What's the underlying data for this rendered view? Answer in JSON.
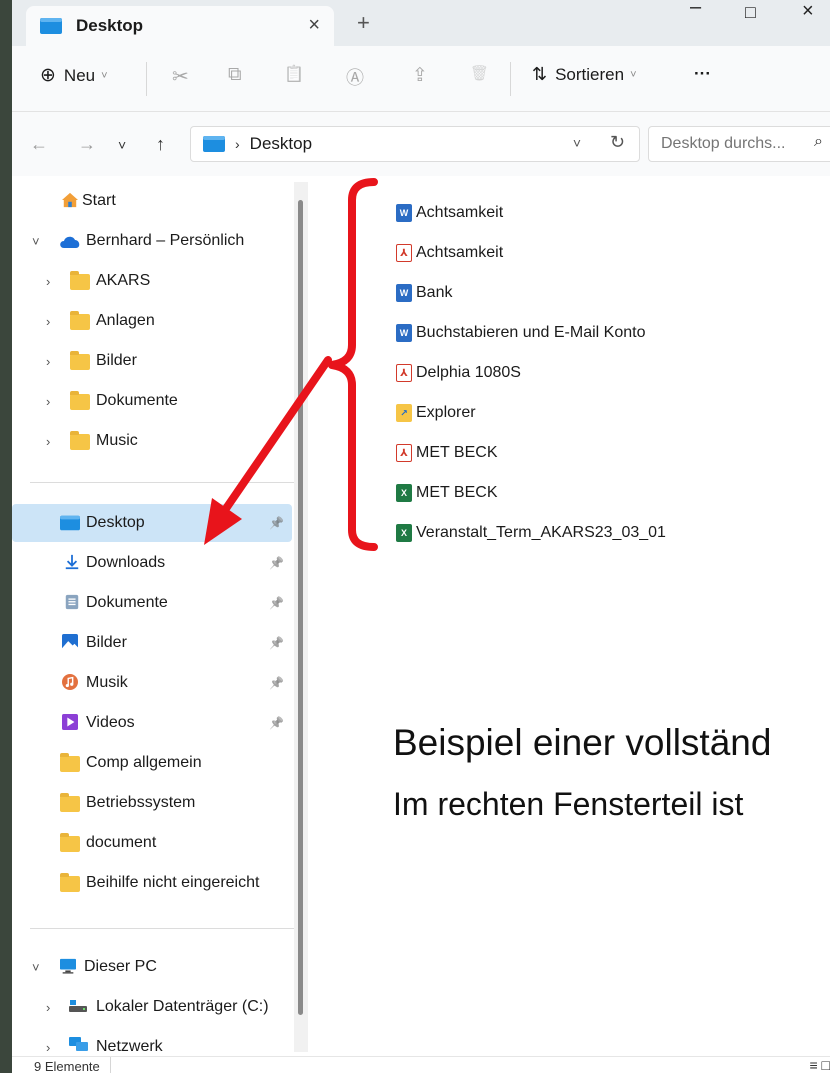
{
  "window": {
    "tab_title": "Desktop",
    "tab_close": "×",
    "new_tab": "+",
    "minimize": "–",
    "maximize": "□",
    "close": "×"
  },
  "toolbar": {
    "new_icon": "⊕",
    "new_label": "Neu",
    "new_chevron": "˅",
    "cut_icon": "✂",
    "copy_icon": "⧉",
    "paste_icon": "📋",
    "rename_icon": "Ⓐ",
    "share_icon": "⇪",
    "delete_icon": "🗑",
    "sort_icon": "⇅",
    "sort_label": "Sortieren",
    "sort_chevron": "˅",
    "more_label": "···"
  },
  "navigation": {
    "back": "←",
    "forward": "→",
    "recent": "˅",
    "up": "↑"
  },
  "address": {
    "separator": "›",
    "crumb": "Desktop",
    "dropdown": "˅",
    "refresh": "↻"
  },
  "search": {
    "placeholder": "Desktop durchs...",
    "icon": "⌕"
  },
  "sidebar": {
    "start": "Start",
    "cloud": "Bernhard – Persönlich",
    "cloud_folders": [
      "AKARS",
      "Anlagen",
      "Bilder",
      "Dokumente",
      "Music"
    ],
    "quick_access": [
      {
        "label": "Desktop",
        "pinned": true,
        "selected": true
      },
      {
        "label": "Downloads",
        "pinned": true
      },
      {
        "label": "Dokumente",
        "pinned": true
      },
      {
        "label": "Bilder",
        "pinned": true
      },
      {
        "label": "Musik",
        "pinned": true
      },
      {
        "label": "Videos",
        "pinned": true
      },
      {
        "label": "Comp allgemein"
      },
      {
        "label": "Betriebssystem"
      },
      {
        "label": "document"
      },
      {
        "label": "Beihilfe nicht eingereicht"
      }
    ],
    "this_pc": "Dieser PC",
    "local_drive": "Lokaler Datenträger (C:)",
    "network": "Netzwerk",
    "expand_glyph": "›",
    "collapse_glyph": "˅",
    "pin_glyph": "📌"
  },
  "files": [
    {
      "name": "Achtsamkeit",
      "type": "word"
    },
    {
      "name": "Achtsamkeit",
      "type": "pdf"
    },
    {
      "name": "Bank",
      "type": "word"
    },
    {
      "name": "Buchstabieren und E-Mail Konto",
      "type": "word"
    },
    {
      "name": "Delphia 1080S",
      "type": "pdf"
    },
    {
      "name": "Explorer",
      "type": "shortcut"
    },
    {
      "name": "MET BECK",
      "type": "pdf"
    },
    {
      "name": "MET BECK",
      "type": "excel"
    },
    {
      "name": "Veranstalt_Term_AKARS23_03_01",
      "type": "excel"
    }
  ],
  "file_icon_glyphs": {
    "word": "W",
    "pdf": "⅄",
    "excel": "X",
    "shortcut": "↗"
  },
  "overlay": {
    "heading": "Beispiel einer vollständ",
    "subheading": "Im rechten Fensterteil ist"
  },
  "status": {
    "count": "9 Elemente",
    "view_details": "≡",
    "view_tiles": "□"
  },
  "colors": {
    "annotation_red": "#e8141b",
    "selection": "#cce4f7",
    "folder_yellow": "#f6c546",
    "accent_blue": "#1d68c9"
  }
}
